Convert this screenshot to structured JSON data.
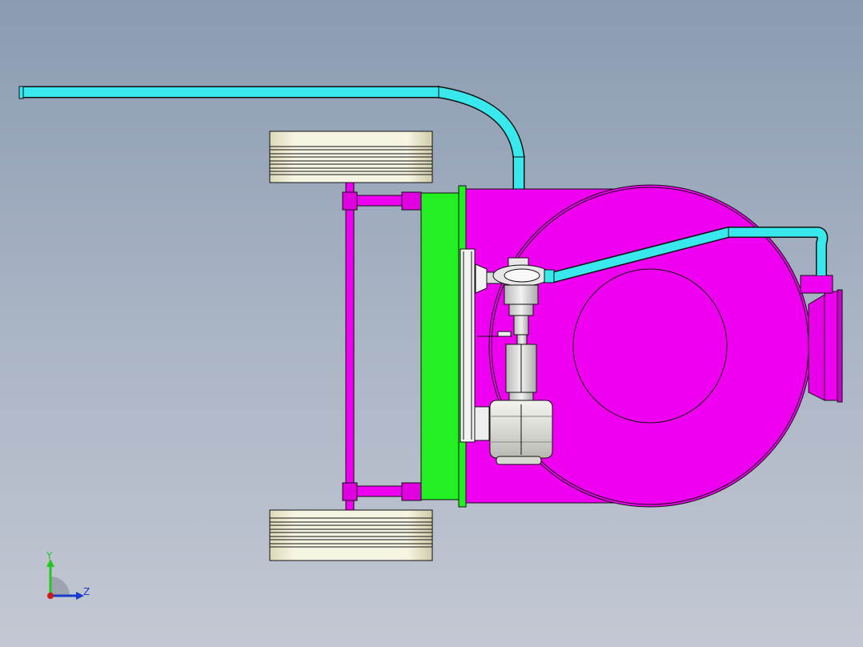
{
  "viewport": {
    "background_top": "#8b9bb2",
    "background_bottom": "#c3c8d3"
  },
  "colors": {
    "pipe": "#38e8ec",
    "housing": "#f000f0",
    "plate": "#22f022",
    "wheel": "#f4f2dc",
    "motor": "#e8e8e2",
    "pump": "#dcdcdc",
    "edge": "#111111"
  },
  "triad": {
    "y_label": "Y",
    "z_label": "Z",
    "y_color": "#22c822",
    "z_color": "#1a3ccc",
    "origin_color": "#d01818"
  }
}
